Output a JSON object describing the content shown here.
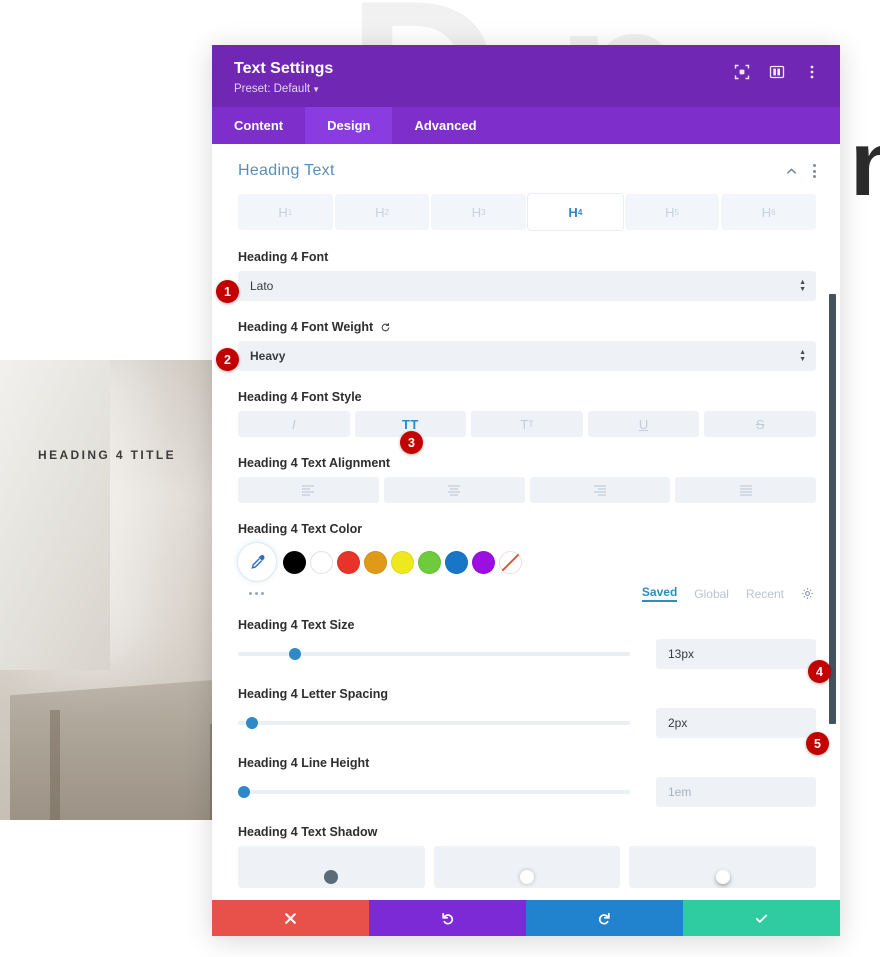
{
  "background": {
    "photo_heading": "HEADING 4 TITLE",
    "big_letter": "n",
    "ghost_letters": [
      "D",
      "n"
    ]
  },
  "modal": {
    "title": "Text Settings",
    "preset_label": "Preset: Default",
    "header_icons": [
      {
        "name": "focus-target-icon",
        "label": "focus"
      },
      {
        "name": "layout-panel-icon",
        "label": "layout"
      },
      {
        "name": "vertical-dots-menu-icon",
        "label": "menu"
      }
    ],
    "tabs": [
      {
        "label": "Content",
        "active": false
      },
      {
        "label": "Design",
        "active": true
      },
      {
        "label": "Advanced",
        "active": false
      }
    ],
    "section": {
      "title": "Heading Text",
      "collapse_icon": "chevron-up-icon",
      "menu_icon": "vertical-dots-icon"
    },
    "heading_levels": [
      {
        "label": "H",
        "sub": "1",
        "active": false
      },
      {
        "label": "H",
        "sub": "2",
        "active": false
      },
      {
        "label": "H",
        "sub": "3",
        "active": false
      },
      {
        "label": "H",
        "sub": "4",
        "active": true
      },
      {
        "label": "H",
        "sub": "5",
        "active": false
      },
      {
        "label": "H",
        "sub": "6",
        "active": false
      }
    ],
    "fields": {
      "font": {
        "label": "Heading 4 Font",
        "value": "Lato",
        "badge": "1"
      },
      "font_weight": {
        "label": "Heading 4 Font Weight",
        "value": "Heavy",
        "badge": "2",
        "reset_icon": "reset-icon"
      },
      "font_style": {
        "label": "Heading 4 Font Style",
        "badge": "3",
        "buttons": [
          {
            "name": "italic",
            "glyph": "I",
            "active": false
          },
          {
            "name": "uppercase",
            "glyph": "TT",
            "active": true
          },
          {
            "name": "small-caps",
            "glyph": "T",
            "glyph_small": "T",
            "active": false
          },
          {
            "name": "underline",
            "glyph": "U",
            "active": false
          },
          {
            "name": "strikethrough",
            "glyph": "S",
            "active": false
          }
        ]
      },
      "text_alignment": {
        "label": "Heading 4 Text Alignment",
        "buttons": [
          {
            "name": "align-left",
            "active": false
          },
          {
            "name": "align-center",
            "active": false
          },
          {
            "name": "align-right",
            "active": false
          },
          {
            "name": "align-justify",
            "active": false
          }
        ]
      },
      "text_color": {
        "label": "Heading 4 Text Color",
        "picker_icon": "eyedropper-icon",
        "swatches": [
          {
            "name": "black",
            "hex": "#000000"
          },
          {
            "name": "white",
            "hex": "#FFFFFF"
          },
          {
            "name": "red",
            "hex": "#E8332A"
          },
          {
            "name": "orange",
            "hex": "#E09A18"
          },
          {
            "name": "yellow",
            "hex": "#F0E81E"
          },
          {
            "name": "green",
            "hex": "#6ECB3C"
          },
          {
            "name": "blue",
            "hex": "#1976C6"
          },
          {
            "name": "purple",
            "hex": "#9B10E0"
          },
          {
            "name": "transparent",
            "hex": "transparent"
          }
        ],
        "more_icon": "more-dots-icon",
        "tabs": [
          {
            "label": "Saved",
            "active": true
          },
          {
            "label": "Global",
            "active": false
          },
          {
            "label": "Recent",
            "active": false
          }
        ],
        "settings_icon": "gear-icon"
      },
      "text_size": {
        "label": "Heading 4 Text Size",
        "value": "13px",
        "badge": "4",
        "slider_percent": 13
      },
      "letter_spacing": {
        "label": "Heading 4 Letter Spacing",
        "value": "2px",
        "badge": "5",
        "slider_percent": 3
      },
      "line_height": {
        "label": "Heading 4 Line Height",
        "placeholder": "1em",
        "value": "",
        "slider_percent": 1
      },
      "text_shadow": {
        "label": "Heading 4 Text Shadow",
        "presets": [
          "none",
          "soft",
          "medium"
        ]
      }
    },
    "footer_buttons": [
      {
        "name": "cancel-button",
        "icon": "close-icon",
        "color": "#E8504A"
      },
      {
        "name": "undo-button",
        "icon": "undo-icon",
        "color": "#7C29D6"
      },
      {
        "name": "redo-button",
        "icon": "redo-icon",
        "color": "#2183CD"
      },
      {
        "name": "save-button",
        "icon": "check-icon",
        "color": "#2ECCA0"
      }
    ]
  }
}
